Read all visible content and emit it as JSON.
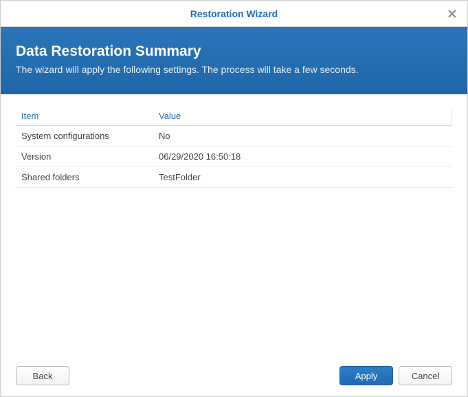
{
  "titlebar": {
    "title": "Restoration Wizard"
  },
  "banner": {
    "title": "Data Restoration Summary",
    "subtitle": "The wizard will apply the following settings. The process will take a few seconds."
  },
  "table": {
    "headers": {
      "item": "Item",
      "value": "Value"
    },
    "rows": [
      {
        "item": "System configurations",
        "value": "No"
      },
      {
        "item": "Version",
        "value": "06/29/2020 16:50:18"
      },
      {
        "item": "Shared folders",
        "value": "TestFolder"
      }
    ]
  },
  "footer": {
    "back": "Back",
    "apply": "Apply",
    "cancel": "Cancel"
  }
}
